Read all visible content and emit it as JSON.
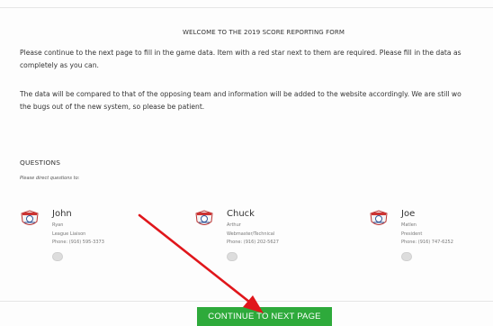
{
  "form": {
    "heading": "WELCOME TO THE 2019 SCORE REPORTING FORM",
    "intro_line1": "Please continue to the next page to fill in the game data.  Item with a red star next to them are required.  Please fill in the data as",
    "intro_line2": "completely as you can.",
    "notice_line1": "The data will be compared to that of the opposing team and information will be added to the website accordingly.  We are still wo",
    "notice_line2": "the bugs out of the new system, so please be patient."
  },
  "questions": {
    "title": "QUESTIONS",
    "subtitle": "Please direct questions to:",
    "contacts": [
      {
        "first": "John",
        "last": "Ryan",
        "role": "League Liaison",
        "phone": "Phone: (916) 595-3373"
      },
      {
        "first": "Chuck",
        "last": "Arthur",
        "role": "Webmaster/Technical",
        "phone": "Phone: (916) 202-5627"
      },
      {
        "first": "Joe",
        "last": "Matlen",
        "role": "President",
        "phone": "Phone: (916) 747-6252"
      }
    ]
  },
  "actions": {
    "continue_label": "CONTINUE TO NEXT PAGE"
  },
  "colors": {
    "button_green": "#2eaa3b",
    "arrow_red": "#e0161b"
  },
  "icons": {
    "contact_logo": "team-logo-icon",
    "annotation": "red-arrow-annotation"
  }
}
